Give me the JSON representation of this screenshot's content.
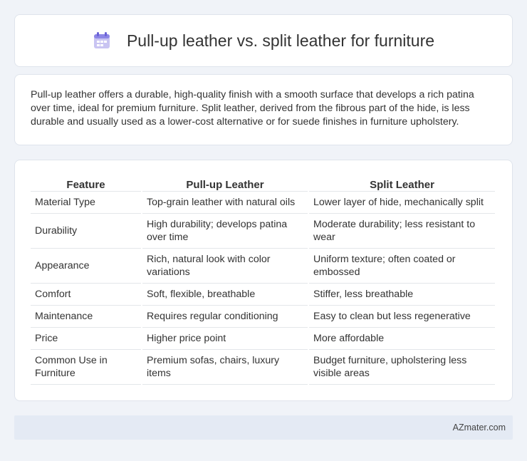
{
  "header": {
    "title": "Pull-up leather vs. split leather for furniture",
    "icon": "calendar-icon"
  },
  "intro": {
    "text": "Pull-up leather offers a durable, high-quality finish with a smooth surface that develops a rich patina over time, ideal for premium furniture. Split leather, derived from the fibrous part of the hide, is less durable and usually used as a lower-cost alternative or for suede finishes in furniture upholstery."
  },
  "table": {
    "headers": [
      "Feature",
      "Pull-up Leather",
      "Split Leather"
    ],
    "rows": [
      [
        "Material Type",
        "Top-grain leather with natural oils",
        "Lower layer of hide, mechanically split"
      ],
      [
        "Durability",
        "High durability; develops patina over time",
        "Moderate durability; less resistant to wear"
      ],
      [
        "Appearance",
        "Rich, natural look with color variations",
        "Uniform texture; often coated or embossed"
      ],
      [
        "Comfort",
        "Soft, flexible, breathable",
        "Stiffer, less breathable"
      ],
      [
        "Maintenance",
        "Requires regular conditioning",
        "Easy to clean but less regenerative"
      ],
      [
        "Price",
        "Higher price point",
        "More affordable"
      ],
      [
        "Common Use in Furniture",
        "Premium sofas, chairs, luxury items",
        "Budget furniture, upholstering less visible areas"
      ]
    ]
  },
  "footer": {
    "brand": "AZmater.com"
  }
}
